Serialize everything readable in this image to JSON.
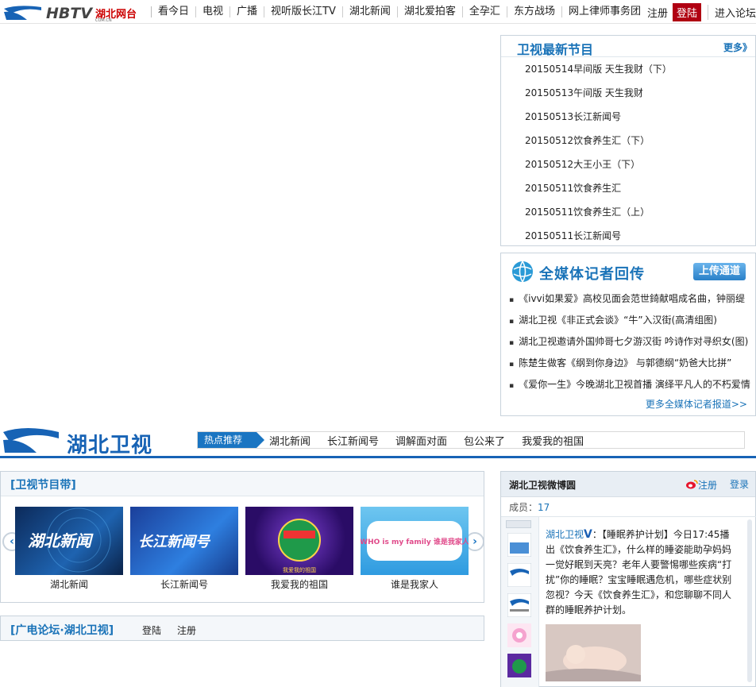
{
  "topnav": {
    "logo_text": "HBTV湖北网台",
    "logo_sub": "COM.CN",
    "items": [
      "看今日",
      "电视",
      "广播",
      "视听版长江TV",
      "湖北新闻",
      "湖北爱拍客",
      "全孕汇",
      "东方战场",
      "网上律师事务团"
    ],
    "register": "注册",
    "login": "登陆",
    "enter": "进入论坛"
  },
  "latest": {
    "title": "卫视最新节目",
    "more": "更多》",
    "items": [
      "20150514早间版 天生我财（下）",
      "20150513午间版 天生我财",
      "20150513长江新闻号",
      "20150512饮食养生汇（下）",
      "20150512大王小王（下）",
      "20150511饮食养生汇",
      "20150511饮食养生汇（上）",
      "20150511长江新闻号"
    ]
  },
  "reporters": {
    "title": "全媒体记者回传",
    "upload": "上传通道",
    "items": [
      "《ivvi如果爱》高校见面会范世錡献唱成名曲，钟丽缇",
      "湖北卫视《非正式会谈》“牛”入汉街(高清组图)",
      "湖北卫视邀请外国帅哥七夕游汉街 吟诗作对寻织女(图)",
      "陈楚生做客《纲到你身边》 与郭德纲“奶爸大比拼”",
      "《爱你一生》今晚湖北卫视首播 演绎平凡人的不朽爱情"
    ],
    "more": "更多全媒体记者报道>>"
  },
  "band": {
    "logo_text": "湖北卫视",
    "hot_label": "热点推荐",
    "hot_links": [
      "湖北新闻",
      "长江新闻号",
      "调解面对面",
      "包公来了",
      "我爱我的祖国"
    ]
  },
  "programs": {
    "title": "[卫视节目带]",
    "prev": "‹",
    "next": "›",
    "items": [
      {
        "title": "湖北新闻",
        "art": "湖北新闻"
      },
      {
        "title": "长江新闻号",
        "art": "长江新闻号"
      },
      {
        "title": "我爱我的祖国",
        "art": "我爱我的祖国"
      },
      {
        "title": "谁是我家人",
        "art": "WHO is my family 谁是我家人"
      }
    ]
  },
  "forum": {
    "title": "[广电论坛·湖北卫视]",
    "login": "登陆",
    "register": "注册"
  },
  "weibo": {
    "title": "湖北卫视微博圆",
    "register": "注册",
    "login": "登录",
    "members_label": "成员：",
    "members_count": "17",
    "user": "湖北卫视",
    "verified": "V",
    "post": "：【睡眠养护计划】今日17:45播出《饮食养生汇》，什么样的睡姿能助孕妈妈一觉好眠到天亮？老年人要警惕哪些疾病“打扰”你的睡眠？宝宝睡眠遇危机，哪些症状别忽视？今天《饮食养生汇》，和您聊聊不同人群的睡眠养护计划。"
  }
}
